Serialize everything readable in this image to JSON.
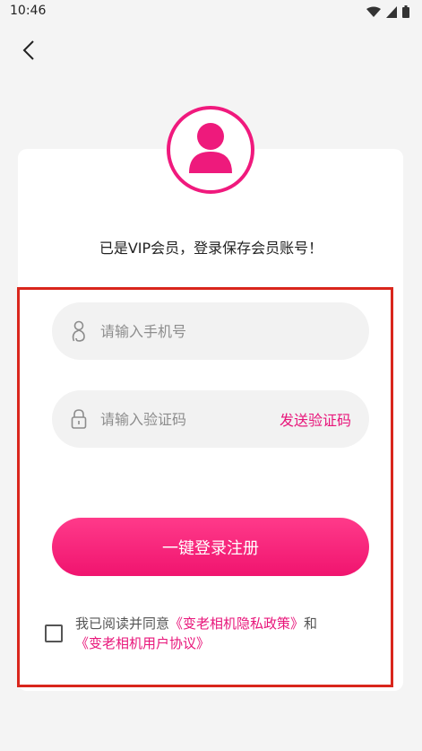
{
  "status_bar": {
    "time": "10:46"
  },
  "header": {
    "back_icon": "chevron-left-icon"
  },
  "avatar": {
    "icon": "user-icon",
    "ring_color": "#f0197d"
  },
  "vip_message": "已是VIP会员，登录保存会员账号！",
  "form": {
    "phone": {
      "icon": "phone-person-icon",
      "placeholder": "请输入手机号",
      "value": ""
    },
    "code": {
      "icon": "lock-icon",
      "placeholder": "请输入验证码",
      "value": "",
      "send_label": "发送验证码"
    },
    "login_label": "一键登录注册"
  },
  "agreement": {
    "checked": false,
    "prefix": "我已阅读并同意",
    "privacy_link": "《变老相机隐私政策》",
    "conjunction": "和",
    "terms_link": "《变老相机用户协议》"
  },
  "colors": {
    "accent": "#e8157a",
    "highlight": "#d9261c"
  }
}
